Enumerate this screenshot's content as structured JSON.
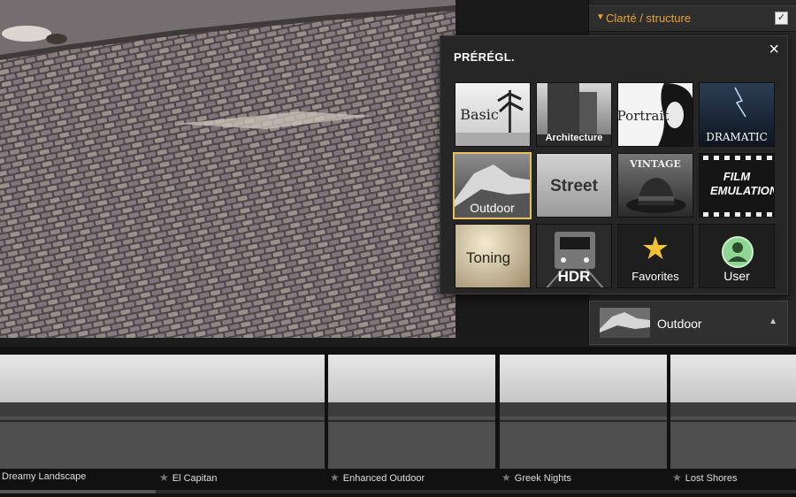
{
  "panel": {
    "header_title": "Clarté / structure",
    "checkbox_checked": true
  },
  "presets_popup": {
    "title": "PRÉRÉGL.",
    "close_glyph": "×",
    "categories": [
      {
        "label": "Basic"
      },
      {
        "label": "Architecture"
      },
      {
        "label": "Portrait"
      },
      {
        "label": "Dramatic"
      },
      {
        "label": "Outdoor",
        "selected": true
      },
      {
        "label": "Street"
      },
      {
        "label": "Vintage"
      },
      {
        "label": "Film Emulation"
      },
      {
        "label": "Toning"
      },
      {
        "label": "HDR"
      },
      {
        "label": "Favorites"
      },
      {
        "label": "User"
      }
    ]
  },
  "selector": {
    "label": "Outdoor",
    "arrow_glyph": "▲"
  },
  "filmstrip": [
    {
      "name": "Dreamy Landscape",
      "star": false
    },
    {
      "name": "El Capitan",
      "star": true
    },
    {
      "name": "Enhanced Outdoor",
      "star": true
    },
    {
      "name": "Greek Nights",
      "star": true
    },
    {
      "name": "Lost Shores",
      "star": true
    }
  ],
  "colors": {
    "accent": "#e8a33a",
    "selected_border": "#e8c15a"
  }
}
